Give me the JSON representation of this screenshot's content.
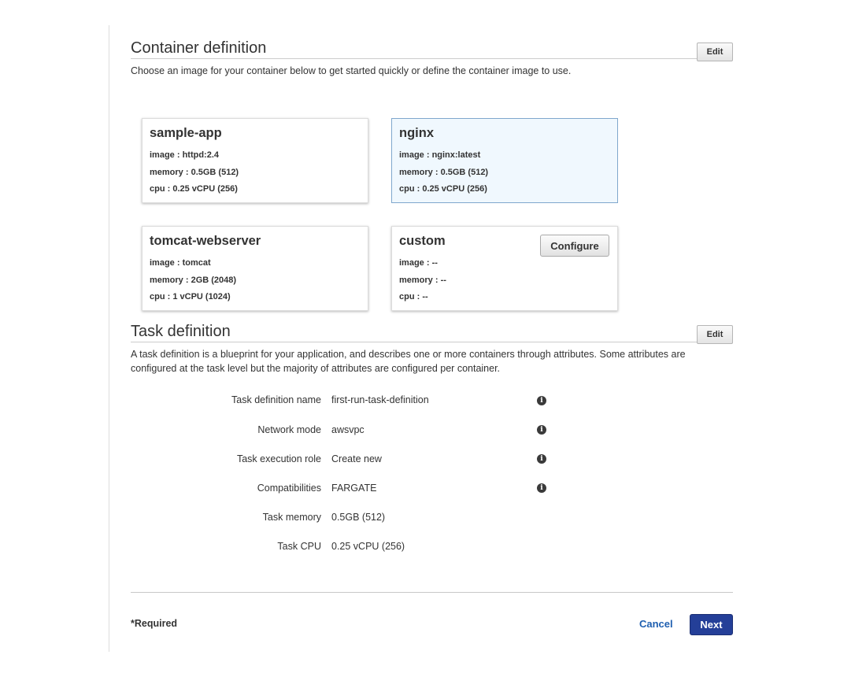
{
  "container_definition": {
    "title": "Container definition",
    "edit_label": "Edit",
    "description": "Choose an image for your container below to get started quickly or define the container image to use.",
    "cards": [
      {
        "name": "sample-app",
        "image": "image : httpd:2.4",
        "memory": "memory :  0.5GB (512)",
        "cpu": "cpu :  0.25 vCPU (256)"
      },
      {
        "name": "nginx",
        "image": "image : nginx:latest",
        "memory": "memory :  0.5GB (512)",
        "cpu": "cpu :  0.25 vCPU (256)"
      },
      {
        "name": "tomcat-webserver",
        "image": "image : tomcat",
        "memory": "memory :  2GB (2048)",
        "cpu": "cpu :  1 vCPU (1024)"
      },
      {
        "name": "custom",
        "image": "image : --",
        "memory": "memory :  --",
        "cpu": "cpu :  --",
        "configure_label": "Configure"
      }
    ]
  },
  "task_definition": {
    "title": "Task definition",
    "edit_label": "Edit",
    "description": "A task definition is a blueprint for your application, and describes one or more containers through attributes. Some attributes are configured at the task level but the majority of attributes are configured per container.",
    "fields": [
      {
        "label": "Task definition name",
        "value": "first-run-task-definition"
      },
      {
        "label": "Network mode",
        "value": "awsvpc"
      },
      {
        "label": "Task execution role",
        "value": "Create new"
      },
      {
        "label": "Compatibilities",
        "value": "FARGATE"
      },
      {
        "label": "Task memory",
        "value": "0.5GB (512)"
      },
      {
        "label": "Task CPU",
        "value": "0.25 vCPU (256)"
      }
    ]
  },
  "footer": {
    "required_label": "*Required",
    "cancel_label": "Cancel",
    "next_label": "Next"
  },
  "icons": {
    "info": "info-icon"
  },
  "colors": {
    "primary_button": "#243f98",
    "link": "#1f5fb0",
    "selected_card_bg": "#f0f8fe",
    "selected_card_border": "#7fa7cd"
  }
}
